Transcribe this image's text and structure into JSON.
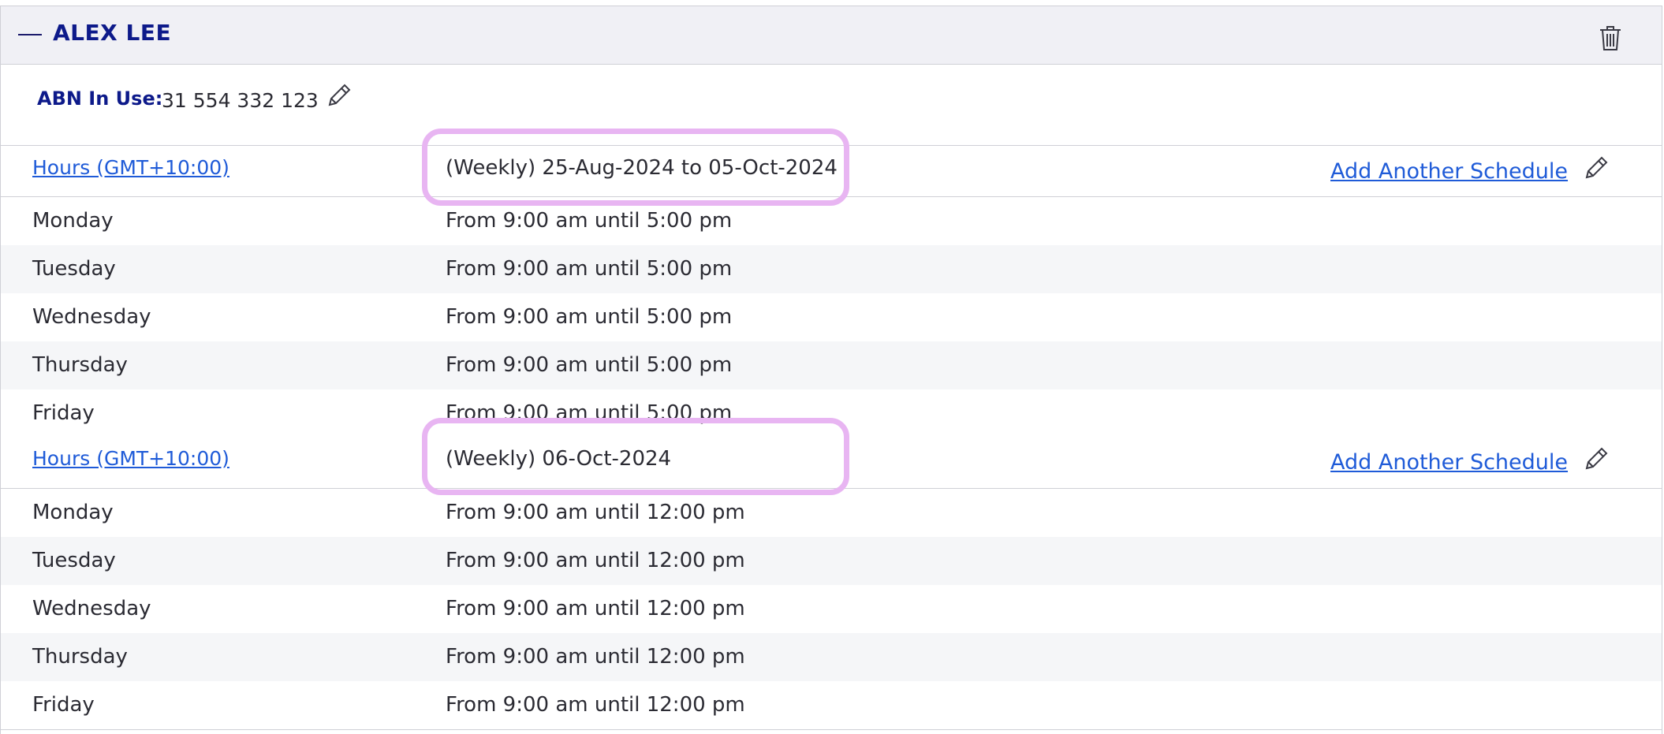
{
  "person": {
    "name": "ALEX LEE"
  },
  "abn": {
    "label": "ABN In Use:",
    "value": "31 554 332 123"
  },
  "schedules": [
    {
      "hours_link": "Hours (GMT+10:00)",
      "period": "(Weekly) 25-Aug-2024 to 05-Oct-2024",
      "add_link": "Add Another Schedule",
      "days": [
        {
          "day": "Monday",
          "hours": "From 9:00 am until 5:00 pm"
        },
        {
          "day": "Tuesday",
          "hours": "From 9:00 am until 5:00 pm"
        },
        {
          "day": "Wednesday",
          "hours": "From 9:00 am until 5:00 pm"
        },
        {
          "day": "Thursday",
          "hours": "From 9:00 am until 5:00 pm"
        },
        {
          "day": "Friday",
          "hours": "From 9:00 am until 5:00 pm"
        }
      ]
    },
    {
      "hours_link": "Hours (GMT+10:00)",
      "period": "(Weekly) 06-Oct-2024",
      "add_link": "Add Another Schedule",
      "days": [
        {
          "day": "Monday",
          "hours": "From 9:00 am until 12:00 pm"
        },
        {
          "day": "Tuesday",
          "hours": "From 9:00 am until 12:00 pm"
        },
        {
          "day": "Wednesday",
          "hours": "From 9:00 am until 12:00 pm"
        },
        {
          "day": "Thursday",
          "hours": "From 9:00 am until 12:00 pm"
        },
        {
          "day": "Friday",
          "hours": "From 9:00 am until 12:00 pm"
        }
      ]
    }
  ],
  "icons": {
    "collapse": "minus-icon",
    "delete": "trash-icon",
    "edit": "pencil-icon"
  },
  "colors": {
    "title": "#0d1a8a",
    "link": "#1f5bd8",
    "highlight": "#e8b5f2",
    "header_bg": "#f0f0f5",
    "alt_row": "#f5f6f8"
  }
}
